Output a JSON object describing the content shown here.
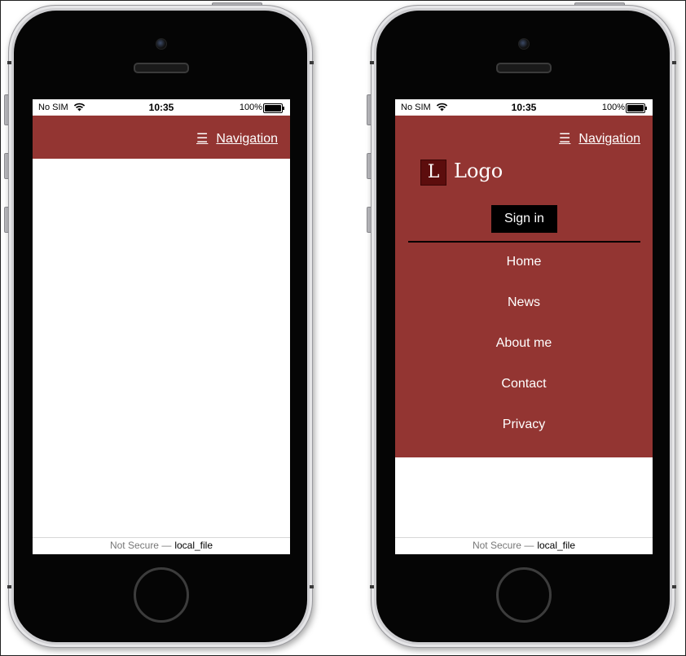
{
  "status_bar": {
    "carrier": "No SIM",
    "time": "10:35",
    "battery_pct": "100%"
  },
  "header": {
    "menu_icon": "☰",
    "nav_label": "Navigation"
  },
  "menu": {
    "logo_letter": "L",
    "logo_text": "Logo",
    "sign_in": "Sign in",
    "items": [
      "Home",
      "News",
      "About me",
      "Contact",
      "Privacy"
    ]
  },
  "url_bar": {
    "security": "Not Secure —",
    "location": "local_file"
  },
  "colors": {
    "brand": "#933532",
    "logo_box": "#5c0d0d",
    "sign_in_bg": "#000000"
  },
  "icons": {
    "wifi": "wifi-icon",
    "battery": "battery-icon",
    "menu": "hamburger-icon"
  }
}
